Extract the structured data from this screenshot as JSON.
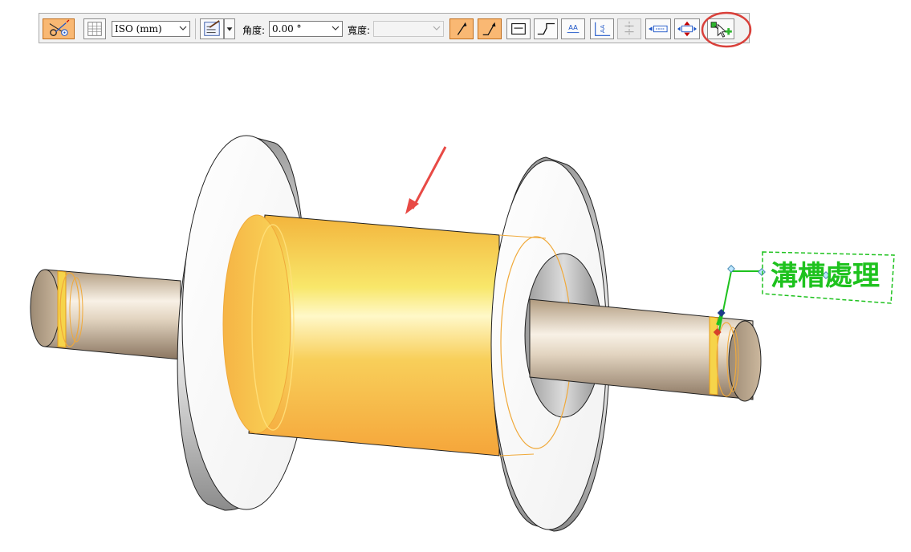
{
  "toolbar": {
    "standard_select": "ISO (mm)",
    "angle_label": "角度:",
    "angle_value": "0.00 °",
    "width_label": "寬度:",
    "width_value": "",
    "text_style_button": "AA",
    "text_vertical_glyph": "AA"
  },
  "annotation": {
    "callout_text": "溝槽處理"
  },
  "colors": {
    "active_button": "#f9b873",
    "callout_green": "#1ec21e",
    "highlight_circle": "#d9403a",
    "pointer_arrow": "#e84a45"
  }
}
